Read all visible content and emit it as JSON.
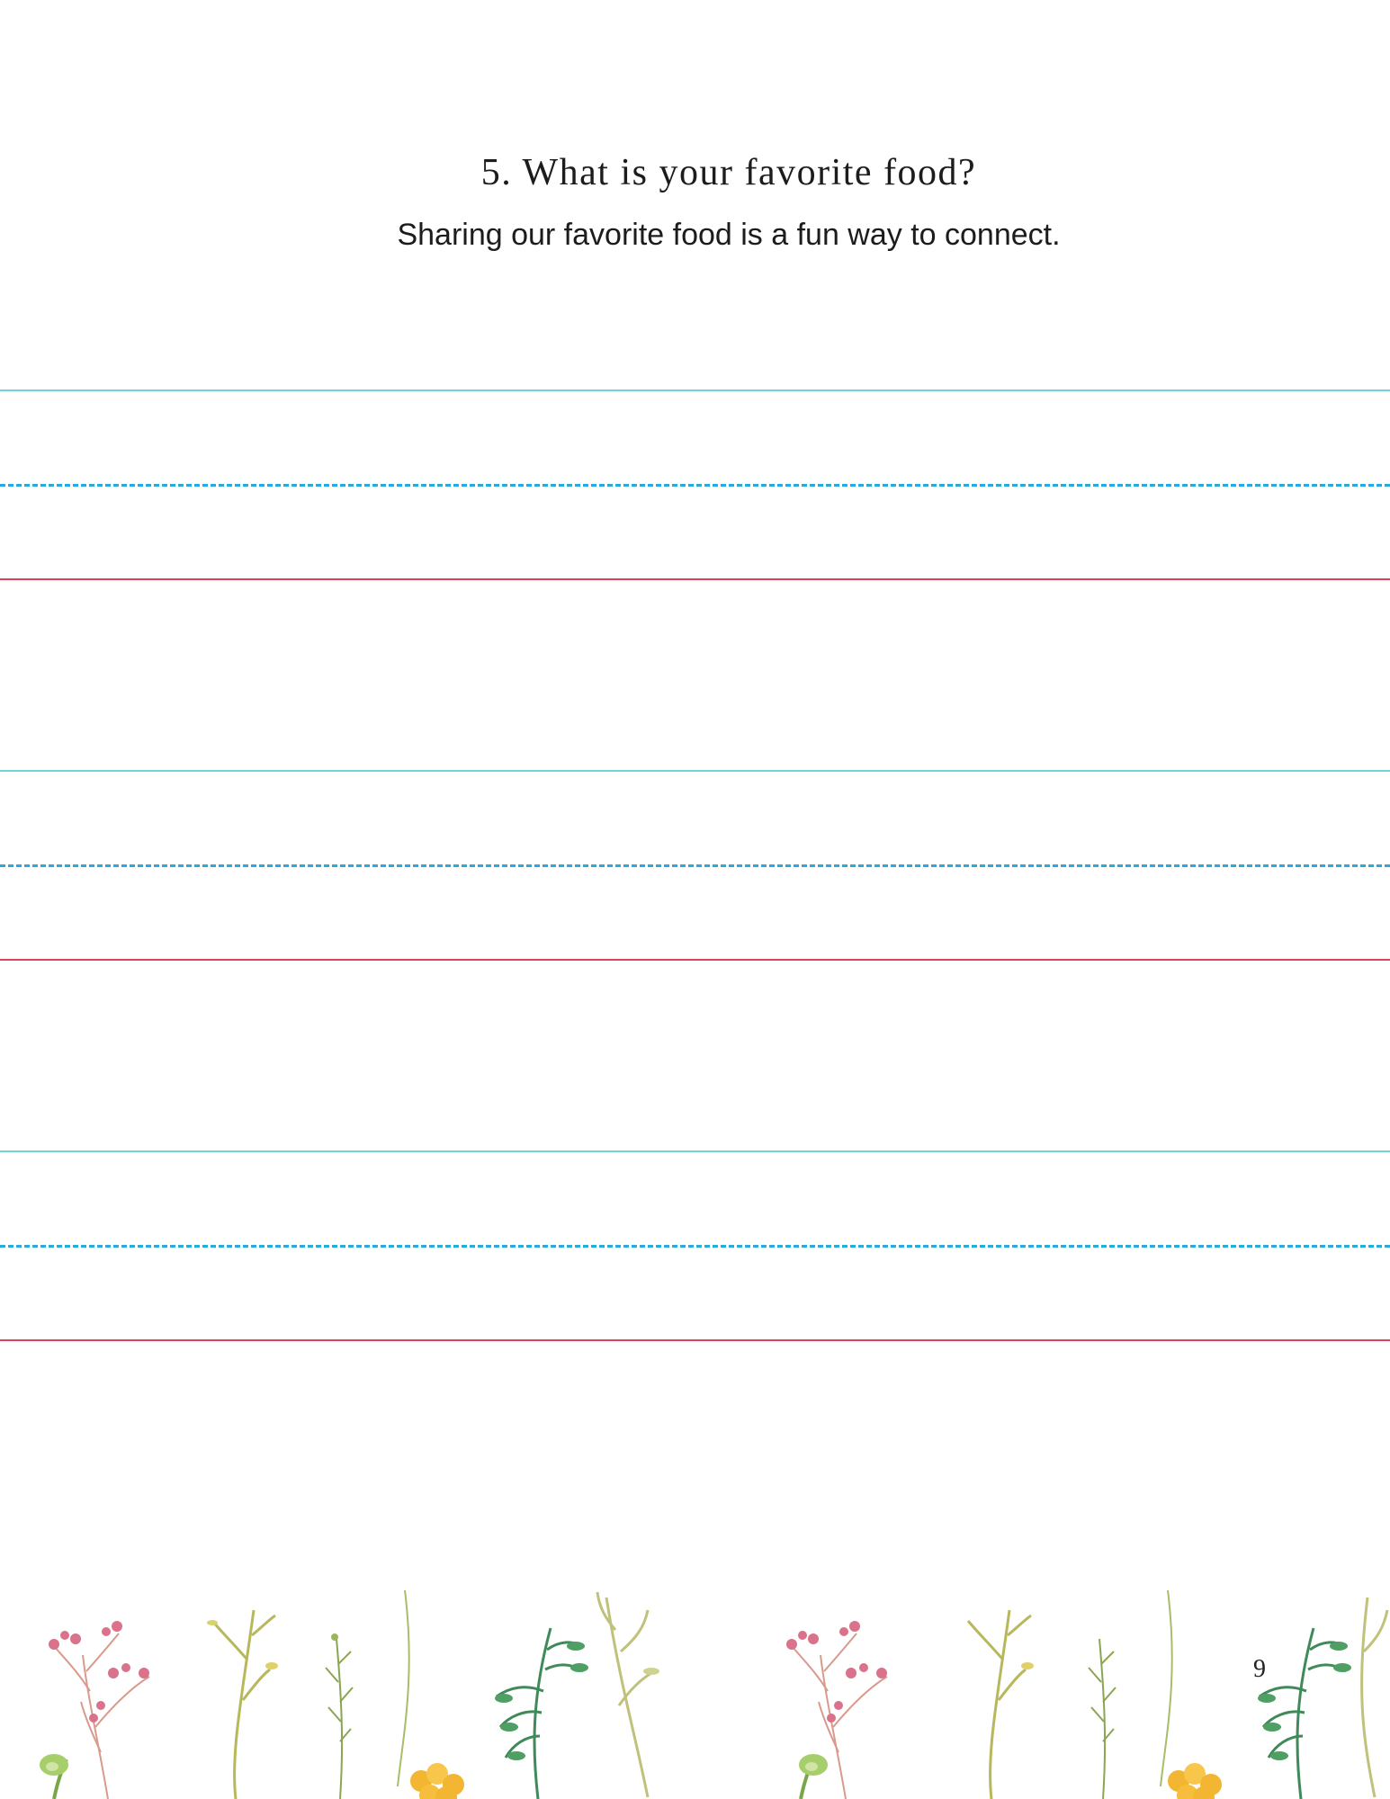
{
  "worksheet": {
    "question": "5. What is your favorite food?",
    "prompt": "Sharing our favorite food is a fun way to connect."
  },
  "writing_lines": {
    "count": 3,
    "colors": {
      "top_line": "#6fd3d8",
      "middle_dashed_line": "#2aa9dd",
      "baseline": "#d9455b"
    }
  },
  "decoration": {
    "style": "watercolor wildflower border",
    "colors": {
      "pink_flower": "#d9728a",
      "leaf_green": "#7aa64a",
      "fern_green": "#3f8a58",
      "yellow_flower": "#f2b632",
      "stem_olive": "#b7b85c"
    }
  },
  "footer": {
    "page_number": "9"
  }
}
